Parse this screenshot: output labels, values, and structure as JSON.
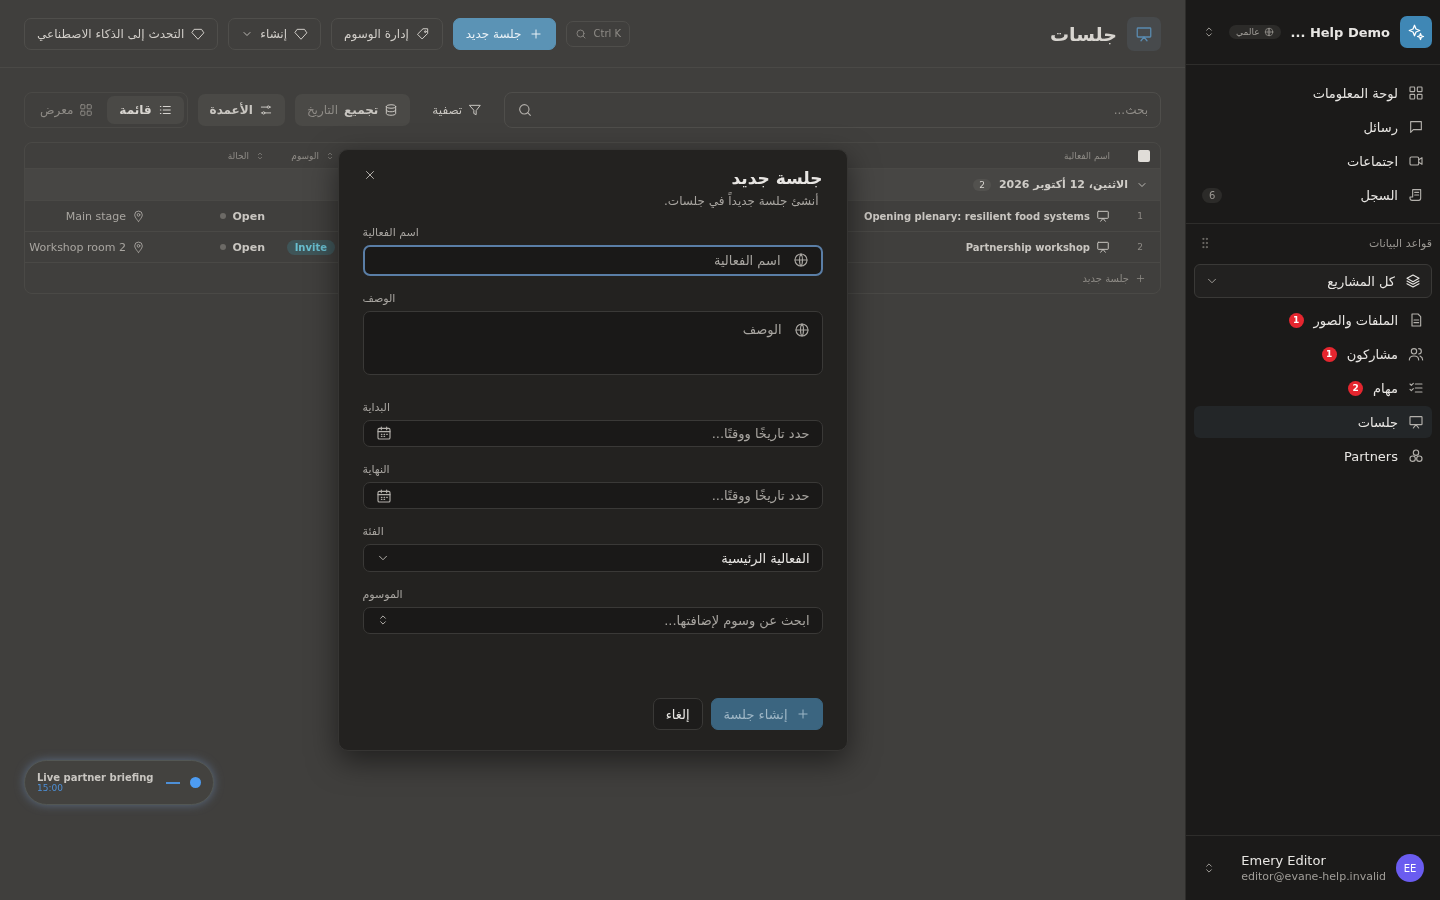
{
  "sidebar": {
    "workspace": {
      "name": "... Help Demo",
      "badge": "عالمي"
    },
    "nav": [
      {
        "label": "لوحة المعلومات"
      },
      {
        "label": "رسائل"
      },
      {
        "label": "اجتماعات"
      },
      {
        "label": "السجل",
        "count": "6"
      }
    ],
    "section_title": "قواعد البيانات",
    "project_select": "كل المشاريع",
    "databases": [
      {
        "label": "الملفات والصور",
        "badge": "1",
        "selected": false
      },
      {
        "label": "مشاركون",
        "badge": "1",
        "selected": false
      },
      {
        "label": "مهام",
        "badge": "2",
        "selected": false
      },
      {
        "label": "جلسات",
        "selected": true
      },
      {
        "label": "Partners",
        "selected": false
      }
    ],
    "user": {
      "name": "Emery Editor",
      "email": "editor@evane-help.invalid",
      "initials": "EE"
    }
  },
  "header": {
    "title": "جلسات",
    "buttons": [
      {
        "kind": "search",
        "label": "Ctrl K"
      },
      {
        "kind": "primary",
        "label": "جلسة جديد"
      },
      {
        "kind": "tags",
        "label": "إدارة الوسوم"
      },
      {
        "kind": "create",
        "label": "إنشاء"
      },
      {
        "kind": "ai",
        "label": "التحدث إلى الذكاء الاصطناعي"
      }
    ]
  },
  "toolbar": {
    "search_placeholder": "بحث...",
    "filter": "تصفية",
    "group": {
      "label": "تجميع",
      "value": "التاريخ"
    },
    "columns": "الأعمدة",
    "views": [
      {
        "label": "قائمة",
        "selected": true
      },
      {
        "label": "معرض",
        "selected": false
      }
    ]
  },
  "table": {
    "select_all_checked": false,
    "columns": [
      "اسم الفعالية",
      "الوسوم",
      "الحالة"
    ],
    "group": {
      "label": "الاثنين، 12 أكتوبر 2026",
      "count": "2",
      "expanded": true
    },
    "rows": [
      {
        "number": "1",
        "name": "Opening plenary: resilient food systems",
        "status": "Open",
        "location": "Main stage"
      },
      {
        "number": "2",
        "name": "Partnership workshop",
        "tag": "Invite",
        "status": "Open",
        "location": "Workshop room 2"
      }
    ],
    "add_label": "جلسة جديد"
  },
  "live_pill": {
    "title": "Live partner briefing",
    "time": "15:00"
  },
  "dialog": {
    "title": "جلسة جديد",
    "subtitle": "أنشئ جلسة جديداً في جلسات.",
    "fields": [
      {
        "kind": "text",
        "label": "اسم الفعالية",
        "placeholder": "اسم الفعالية",
        "focused": true
      },
      {
        "kind": "textarea",
        "label": "الوصف",
        "placeholder": "الوصف",
        "focused": false
      },
      {
        "kind": "datetime",
        "label": "البداية",
        "placeholder": "حدد تاريخًا ووقتًا...",
        "focused": false
      },
      {
        "kind": "datetime",
        "label": "النهاية",
        "placeholder": "حدد تاريخًا ووقتًا...",
        "focused": false
      },
      {
        "kind": "select",
        "label": "الفئة",
        "value": "الفعالية الرئيسية",
        "focused": false
      },
      {
        "kind": "tags",
        "label": "الموسوم",
        "placeholder": "ابحث عن وسوم لإضافتها...",
        "focused": false
      }
    ],
    "create_button": {
      "label": "إنشاء جلسة",
      "disabled": true
    },
    "cancel_button": "إلغاء"
  }
}
